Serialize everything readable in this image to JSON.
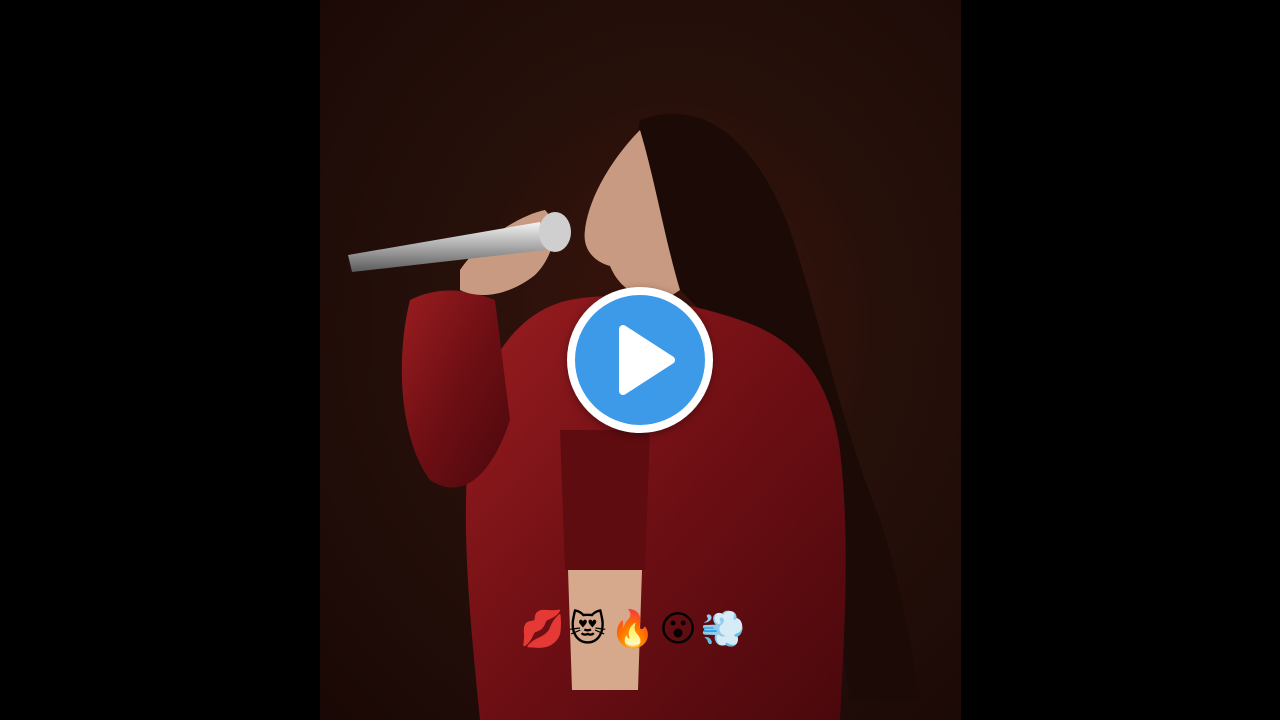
{
  "video": {
    "play_label": "Play video",
    "caption_emojis": [
      "💋",
      "😻",
      "🔥",
      "😮",
      "💨"
    ]
  },
  "colors": {
    "letterbox": "#000000",
    "play_button_fill": "#3d9ae8",
    "play_button_ring": "#ffffff",
    "jacket": "#7a1418"
  }
}
